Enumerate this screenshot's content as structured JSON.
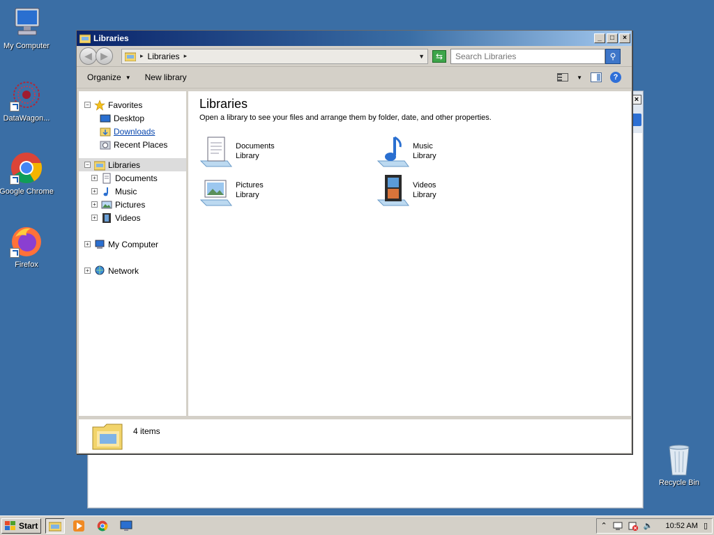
{
  "desktop": {
    "icons": [
      {
        "label": "My Computer",
        "icon": "my-computer-icon"
      },
      {
        "label": "DataWagon...",
        "icon": "datawagon-icon"
      },
      {
        "label": "Google Chrome",
        "icon": "chrome-icon"
      },
      {
        "label": "Firefox",
        "icon": "firefox-icon"
      }
    ],
    "recycle_bin": {
      "label": "Recycle Bin",
      "icon": "recycle-bin-icon"
    }
  },
  "window": {
    "title": "Libraries",
    "controls": {
      "minimize": "_",
      "maximize": "□",
      "close": "×"
    },
    "address": {
      "root_sep": "▸",
      "segment": "Libraries",
      "segment_caret": "▸"
    },
    "search": {
      "placeholder": "Search Libraries"
    },
    "toolbar": {
      "organize": "Organize",
      "new_library": "New library"
    },
    "nav": {
      "favorites": {
        "label": "Favorites",
        "items": [
          "Desktop",
          "Downloads",
          "Recent Places"
        ]
      },
      "libraries": {
        "label": "Libraries",
        "items": [
          "Documents",
          "Music",
          "Pictures",
          "Videos"
        ]
      },
      "computer": "My Computer",
      "network": "Network"
    },
    "content": {
      "heading": "Libraries",
      "description": "Open a library to see your files and arrange them by folder, date, and other properties.",
      "libraries": [
        {
          "name": "Documents",
          "type": "Library",
          "icon": "documents-library-icon"
        },
        {
          "name": "Music",
          "type": "Library",
          "icon": "music-library-icon"
        },
        {
          "name": "Pictures",
          "type": "Library",
          "icon": "pictures-library-icon"
        },
        {
          "name": "Videos",
          "type": "Library",
          "icon": "videos-library-icon"
        }
      ]
    },
    "status": {
      "count": "4 items"
    }
  },
  "taskbar": {
    "start": "Start",
    "clock": "10:52 AM"
  },
  "colors": {
    "desktop": "#3a6ea5",
    "titlebar_start": "#0a246a",
    "link": "#0645ad"
  }
}
